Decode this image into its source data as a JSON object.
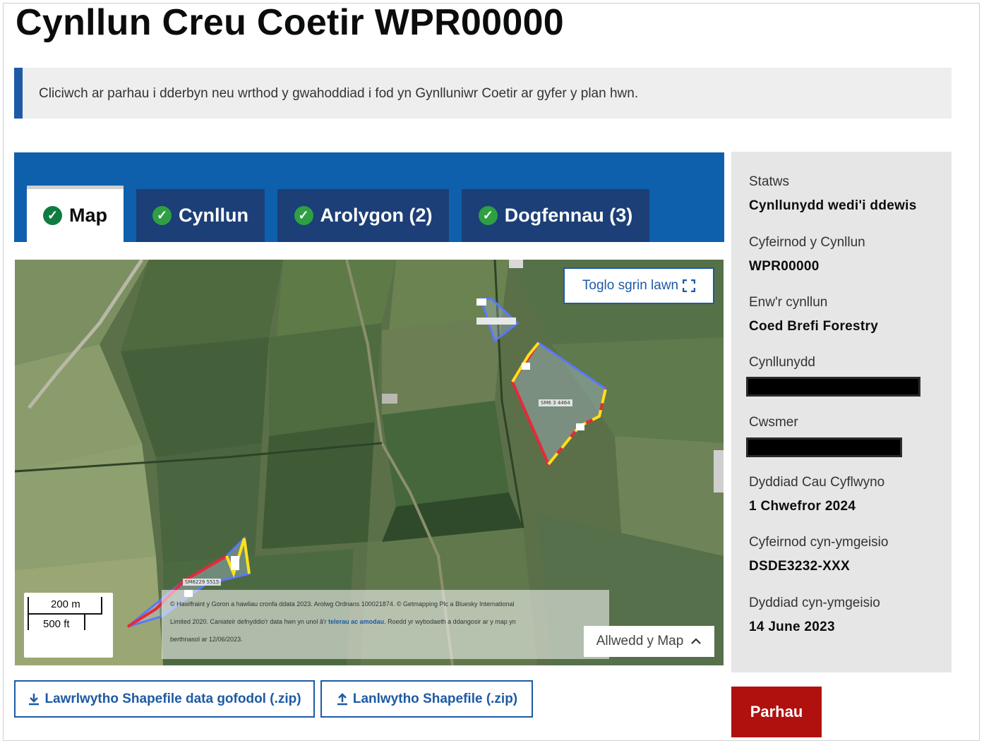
{
  "page": {
    "title": "Cynllun Creu Coetir WPR00000"
  },
  "notice": {
    "text": "Cliciwch ar parhau i dderbyn neu wrthod y gwahoddiad i fod yn Gynlluniwr Coetir ar gyfer y plan hwn."
  },
  "tabs": [
    {
      "label": "Map",
      "active": true
    },
    {
      "label": "Cynllun",
      "active": false
    },
    {
      "label": "Arolygon (2)",
      "active": false
    },
    {
      "label": "Dogfennau (3)",
      "active": false
    }
  ],
  "map": {
    "fullscreen_label": "Toglo sgrin lawn",
    "scale": {
      "metric": "200 m",
      "imperial": "500 ft"
    },
    "attribution": {
      "line1": "© Hawlfraint y Goron a hawliau cronfa ddata 2023. Arolwg Ordnans 100021874. © Getmapping Plc a Bluesky International",
      "line2_start": "Limited 2020. Caniateir defnyddio'r data hwn yn unol â'r",
      "line2_link": "telerau ac amodau",
      "line2_end": ". Roedd yr wybodaeth a ddangosir ar y map yn",
      "line3": "berthnasol ar 12/06/2023."
    },
    "legend_label": "Allwedd y Map",
    "parcel_labels": [
      "SM6229 5515",
      "SM6 3 4464"
    ]
  },
  "buttons": {
    "download": "Lawrlwytho Shapefile data gofodol (.zip)",
    "upload": "Lanlwytho Shapefile (.zip)",
    "continue": "Parhau"
  },
  "summary": {
    "status_label": "Statws",
    "status_value": "Cynllunydd wedi'i ddewis",
    "ref_label": "Cyfeirnod y Cynllun",
    "ref_value": "WPR00000",
    "name_label": "Enw'r cynllun",
    "name_value": "Coed Brefi Forestry",
    "planner_label": "Cynllunydd",
    "customer_label": "Cwsmer",
    "deadline_label": "Dyddiad Cau Cyflwyno",
    "deadline_value": "1 Chwefror 2024",
    "preapp_ref_label": "Cyfeirnod cyn-ymgeisio",
    "preapp_ref_value": "DSDE3232-XXX",
    "preapp_date_label": "Dyddiad cyn-ymgeisio",
    "preapp_date_value": "14 June 2023"
  },
  "colors": {
    "brand_blue": "#0e60ac",
    "tab_blue": "#1c3f77",
    "check_green": "#2ea043",
    "continue_red": "#b0110f",
    "boundary_red": "#e8283a",
    "boundary_yellow": "#ffe21a",
    "boundary_blue": "#5a78ff"
  }
}
